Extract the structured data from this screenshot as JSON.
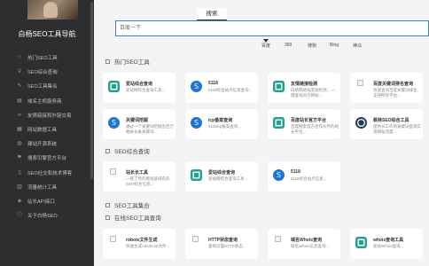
{
  "sidebar": {
    "title": "白杨SEO工具导航",
    "items": [
      {
        "label": "热门SEO工具",
        "icon": "star-icon"
      },
      {
        "label": "SEO综合查询",
        "icon": "search-icon"
      },
      {
        "label": "SEO工具集合",
        "icon": "wrench-icon"
      },
      {
        "label": "域名主机服务商",
        "icon": "server-icon"
      },
      {
        "label": "友情链接和外链交易",
        "icon": "link-icon"
      },
      {
        "label": "网站数据工具",
        "icon": "chart-icon"
      },
      {
        "label": "建站开源系统",
        "icon": "globe-icon"
      },
      {
        "label": "搜索引擎官方平台",
        "icon": "flag-icon"
      },
      {
        "label": "SEO社交和技术博客",
        "icon": "book-icon"
      },
      {
        "label": "流量统计工具",
        "icon": "bar-chart-icon"
      },
      {
        "label": "站长API接口",
        "icon": "api-icon"
      },
      {
        "label": "关于白杨SEO",
        "icon": "info-icon"
      }
    ]
  },
  "search": {
    "tab": "搜索",
    "placeholder": "百度一下",
    "engines": [
      "百度",
      "360",
      "搜狗",
      "Bing",
      "神马"
    ],
    "active_engine": "百度"
  },
  "sections": {
    "hot": {
      "title": "热门SEO工具"
    },
    "comprehensive": {
      "title": "SEO综合查询"
    },
    "toolset": {
      "title": "SEO工具集合"
    },
    "online": {
      "title": "在线SEO工具查询"
    }
  },
  "hot_cards": [
    {
      "name": "爱站综合查询",
      "desc": "爱站网综合查询工具...",
      "logo": "teal"
    },
    {
      "name": "5118",
      "desc": "5118综合站点信息查询...",
      "logo": "blue"
    },
    {
      "name": "友情链接检测",
      "desc": "白杨网站站友链检测,...一键查询对方网站...",
      "logo": "teal"
    },
    {
      "name": "百度关键词排名查询",
      "desc": "快速查询百度关键词排名,支持所有平台...",
      "logo": "broken"
    },
    {
      "name": "关键词挖掘",
      "desc": "通过一个关键词挖掘出百万相关长尾关键词...",
      "logo": "blue"
    },
    {
      "name": "icp备案查询",
      "desc": "5118icp备案查询...",
      "logo": "blue"
    },
    {
      "name": "百度站长官方平台",
      "desc": "百度搜索官方合作伙伴的站长平台...",
      "logo": "teal"
    },
    {
      "name": "枫林SEO综合工具",
      "desc": "提供从工作到关键词监测实现网站流量...",
      "logo": "navy"
    }
  ],
  "comprehensive_cards": [
    {
      "name": "站长长工具",
      "desc": "一目了然的看到该域名的SEO综合信息...",
      "logo": "broken"
    },
    {
      "name": "爱站综合查询",
      "desc": "爱站网综合查询工具...",
      "logo": "teal"
    },
    {
      "name": "5118",
      "desc": "5118综合站点信息...",
      "logo": "blue"
    }
  ],
  "online_cards": [
    {
      "name": "robots文件生成",
      "desc": "快速生成robots.txt文件...",
      "logo": "broken"
    },
    {
      "name": "HTTP状态查询",
      "desc": "查询页面HTTP状态...",
      "logo": "broken"
    },
    {
      "name": "域名Whois查询",
      "desc": "域名Whois信息查询...",
      "logo": "broken"
    },
    {
      "name": "whois查询工具",
      "desc": "爱站Whois查询...",
      "logo": "teal"
    }
  ],
  "colors": {
    "sidebar_bg": "#2c2e2f",
    "accent": "#3d7bd9",
    "teal": "#1aa38a",
    "blue": "#1f74d8"
  }
}
